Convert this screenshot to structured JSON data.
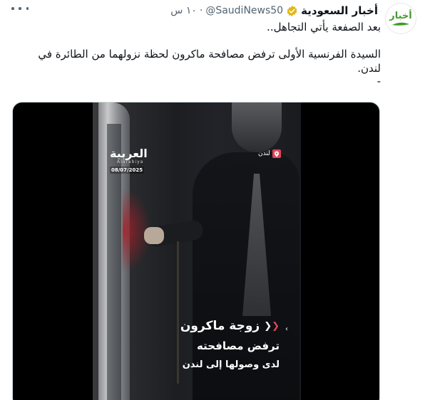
{
  "account": {
    "display_name": "أخبار السعودية",
    "handle": "@SaudiNews50",
    "separator": "·",
    "time": "١٠ س",
    "avatar_text": "أخبار"
  },
  "tweet": {
    "line1": "بعد الصفعة يأتي التجاهل..",
    "line2": "السيدة الفرنسية الأولى ترفض مصافحة ماكرون لحظة نزولهما من الطائرة في لندن.",
    "line3": "-"
  },
  "video": {
    "brand": "العربية",
    "brand_sub": "Alarabiya",
    "date": "08/07/2025",
    "location": "لندن",
    "caption_line1": "زوجة ماكرون",
    "caption_line2": "ترفض مصافحته",
    "caption_line3": "لدى وصولها إلى لندن"
  },
  "colors": {
    "text": "#0f1419",
    "muted": "#536471",
    "verified": "#e2b719",
    "brand_green": "#3f9b2c",
    "accent_red": "#e0465b"
  }
}
